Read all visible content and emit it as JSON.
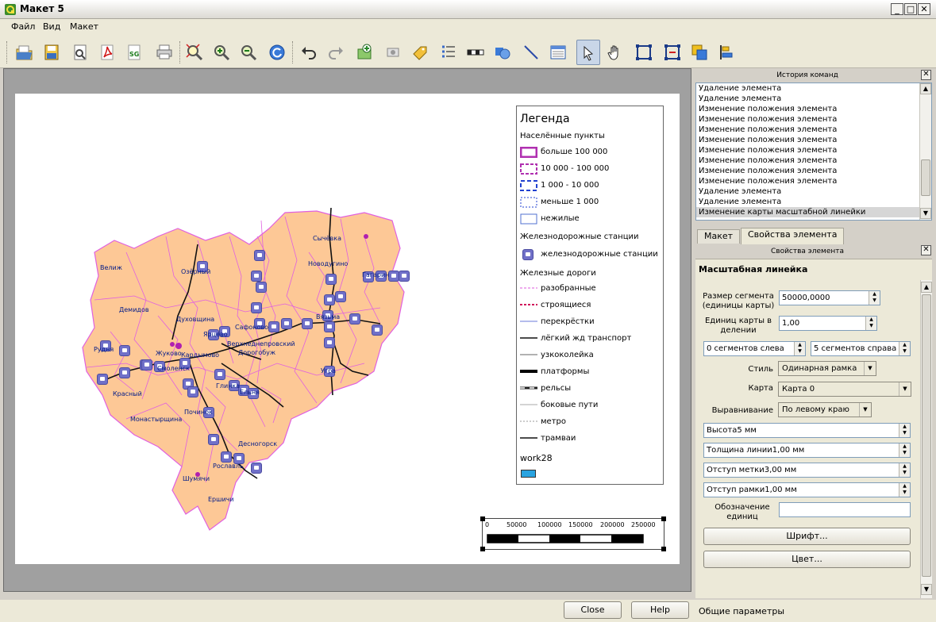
{
  "window": {
    "title": "Макет 5"
  },
  "menu": [
    "Файл",
    "Вид",
    "Макет"
  ],
  "toolbar_icons": [
    "open-icon",
    "save-icon",
    "print-preview-icon",
    "pdf-icon",
    "svg-icon",
    "print-icon",
    "zoom-full-icon",
    "zoom-in-icon",
    "zoom-out-icon",
    "refresh-icon",
    "undo-icon",
    "redo-icon",
    "add-map-icon",
    "add-image-icon",
    "add-label-icon",
    "add-legend-icon",
    "add-scalebar-icon",
    "add-shape-icon",
    "add-arrow-icon",
    "add-table-icon",
    "select-icon",
    "move-content-icon",
    "group-icon",
    "ungroup-icon",
    "raise-icon",
    "align-icon"
  ],
  "history": {
    "title": "История команд",
    "items": [
      "Удаление элемента",
      "Удаление элемента",
      "Изменение положения элемента",
      "Изменение положения элемента",
      "Изменение положения элемента",
      "Изменение положения элемента",
      "Изменение положения элемента",
      "Изменение положения элемента",
      "Изменение положения элемента",
      "Изменение положения элемента",
      "Удаление элемента",
      "Удаление элемента",
      "Изменение карты масштабной линейки"
    ]
  },
  "tabs": [
    "Макет",
    "Свойства элемента"
  ],
  "props": {
    "dock_title": "Свойства элемента",
    "section_title": "Масштабная линейка",
    "segment_size_label": "Размер сегмента (единицы карты)",
    "segment_size_value": "50000,0000",
    "units_per_segment_label": "Единиц карты в делении",
    "units_per_segment_value": "1,00",
    "segments_left": "0 сегментов слева",
    "segments_right": "5 сегментов справа",
    "style_label": "Стиль",
    "style_value": "Одинарная рамка",
    "map_label": "Карта",
    "map_value": "Карта 0",
    "align_label": "Выравнивание",
    "align_value": "По левому краю",
    "height": "Высота5 мм",
    "line_width": "Толщина линии1,00 мм",
    "label_offset": "Отступ метки3,00 мм",
    "frame_offset": "Отступ рамки1,00 мм",
    "units_label": "Обозначение единиц",
    "units_value": "",
    "font_button": "Шрифт...",
    "color_button": "Цвет..."
  },
  "status": {
    "close": "Close",
    "help": "Help",
    "text": "Общие параметры"
  },
  "legend": {
    "title": "Легенда",
    "groups": {
      "settlements": "Населённые пункты",
      "stations": "Железнодорожные станции",
      "railways": "Железные дороги",
      "work": "work28"
    },
    "settlement_items": [
      "больше 100 000",
      "10 000 - 100 000",
      "1 000 - 10 000",
      "меньше 1 000",
      "нежилые"
    ],
    "station_item": "железнодорожные станции",
    "railway_items": [
      "разобранные",
      "строящиеся",
      "перекрёстки",
      "лёгкий жд транспорт",
      "узкоколейка",
      "платформы",
      "рельсы",
      "боковые пути",
      "метро",
      "трамваи"
    ],
    "colors": {
      "magenta": "#b030b0",
      "blue": "#2040d0",
      "work": "#29a3e0",
      "region": "#fdc896",
      "border": "#e060e0"
    }
  },
  "scalebar": {
    "ticks": [
      "0",
      "50000",
      "100000",
      "150000",
      "200000",
      "250000"
    ]
  },
  "map_labels": [
    "Велиж",
    "Озёрный",
    "Демидов",
    "Духовщина",
    "Рудня",
    "Ярцево",
    "Сафоново",
    "Жуково",
    "Кардымово",
    "Смоленск",
    "Верхнеднепровский",
    "Дорогобуж",
    "Красный",
    "Глинка",
    "Ельня",
    "Монастырщина",
    "Починок",
    "Десногорск",
    "Рославль",
    "Шумячи",
    "Ершичи",
    "Сычёвка",
    "Новодугино",
    "Гагарин",
    "Вязьма",
    "Угра"
  ]
}
